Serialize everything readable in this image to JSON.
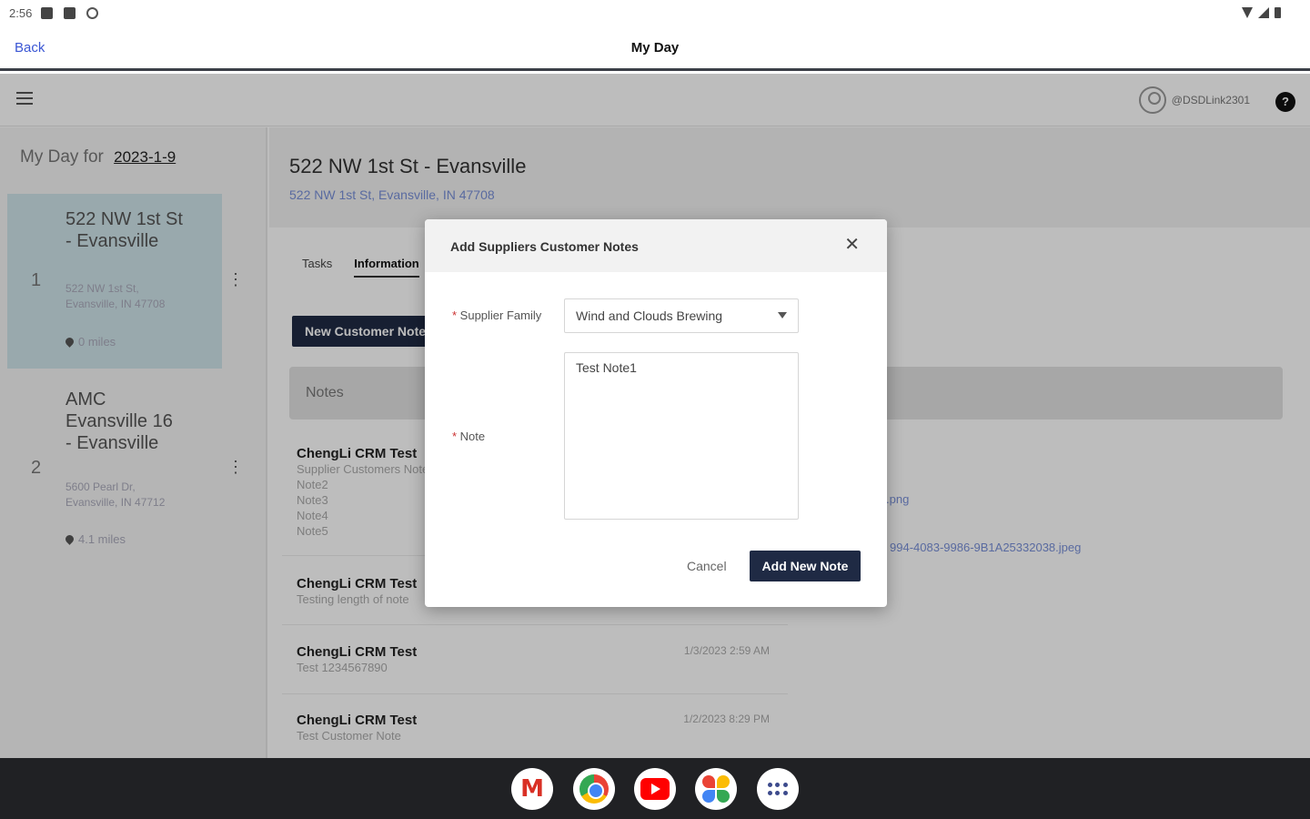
{
  "status_bar": {
    "time": "2:56"
  },
  "titlebar": {
    "back": "Back",
    "title": "My Day"
  },
  "topnav": {
    "username": "@DSDLink2301",
    "help": "?"
  },
  "left": {
    "myday_label": "My Day for",
    "date": "2023-1-9",
    "stops": [
      {
        "num": "1",
        "name": "522 NW 1st St - Evansville",
        "address": "522 NW 1st St, Evansville, IN 47708",
        "miles": "0 miles"
      },
      {
        "num": "2",
        "name": "AMC Evansville 16 - Evansville",
        "address": "5600 Pearl Dr, Evansville, IN 47712",
        "miles": "4.1 miles"
      }
    ]
  },
  "main": {
    "title": "522 NW 1st St - Evansville",
    "address": "522 NW 1st St, Evansville, IN 47708",
    "tabs": [
      "Tasks",
      "Information"
    ],
    "new_button": "New Customer Note",
    "notes_header": "Notes",
    "notes": [
      {
        "title": "ChengLi CRM Test",
        "body": [
          "Supplier Customers Note",
          "Note2",
          "Note3",
          "Note4",
          "Note5"
        ],
        "date": ""
      },
      {
        "title": "ChengLi CRM Test",
        "body": [
          "Testing length of note"
        ],
        "date": ""
      },
      {
        "title": "ChengLi CRM Test",
        "body": [
          "Test 1234567890"
        ],
        "date": "1/3/2023 2:59 AM"
      },
      {
        "title": "ChengLi CRM Test",
        "body": [
          "Test Customer Note"
        ],
        "date": "1/2/2023 8:29 PM"
      }
    ],
    "links": [
      ".png",
      "994-4083-9986-9B1A25332038.jpeg"
    ]
  },
  "modal": {
    "title": "Add Suppliers Customer Notes",
    "supplier_label": "Supplier Family",
    "supplier_value": "Wind and Clouds Brewing",
    "note_label": "Note",
    "note_value": "Test Note1",
    "cancel": "Cancel",
    "submit": "Add New Note"
  },
  "dock": {
    "apps": [
      "gmail-icon",
      "chrome-icon",
      "youtube-icon",
      "photos-icon",
      "app-launcher-icon"
    ]
  }
}
